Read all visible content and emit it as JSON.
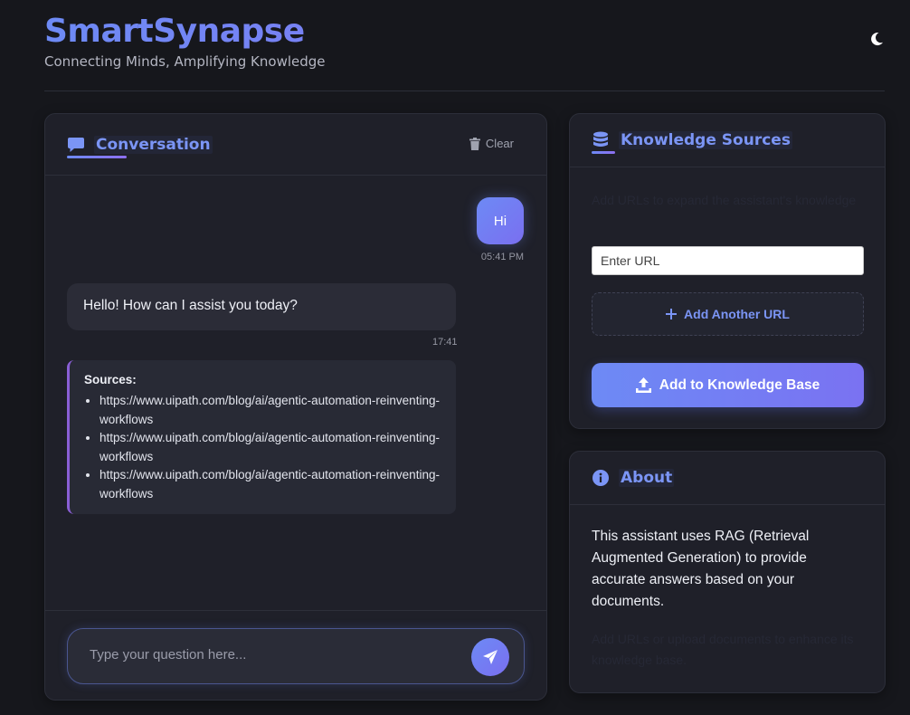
{
  "header": {
    "title": "SmartSynapse",
    "tagline": "Connecting Minds, Amplifying Knowledge",
    "theme_icon": "moon-icon"
  },
  "conversation": {
    "title": "Conversation",
    "icon": "chat-bubble-icon",
    "clear_label": "Clear",
    "messages": {
      "user": {
        "text": "Hi",
        "time": "05:41 PM"
      },
      "bot": {
        "text": "Hello! How can I assist you today?",
        "time": "17:41"
      }
    },
    "sources": {
      "title": "Sources:",
      "items": [
        "https://www.uipath.com/blog/ai/agentic-automation-reinventing-workflows",
        "https://www.uipath.com/blog/ai/agentic-automation-reinventing-workflows",
        "https://www.uipath.com/blog/ai/agentic-automation-reinventing-workflows"
      ]
    },
    "input": {
      "placeholder": "Type your question here...",
      "value": ""
    }
  },
  "knowledge_sources": {
    "title": "Knowledge Sources",
    "icon": "database-icon",
    "description": "Add URLs to expand the assistant's knowledge",
    "url_placeholder": "Enter URL",
    "add_url_label": "Add Another URL",
    "add_kb_label": "Add to Knowledge Base"
  },
  "about": {
    "title": "About",
    "icon": "info-icon",
    "text": "This assistant uses RAG (Retrieval Augmented Generation) to provide accurate answers based on your documents.",
    "note": "Add URLs or upload documents to enhance its knowledge base."
  },
  "colors": {
    "accent": "#6d8af5",
    "accent_purple": "#8d6ff0",
    "background": "#16171c",
    "card": "#1f2029"
  }
}
